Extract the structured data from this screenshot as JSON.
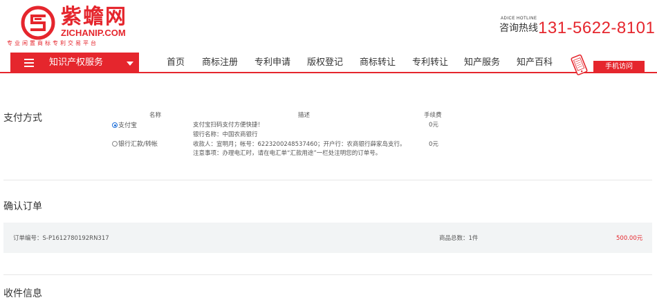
{
  "brand": {
    "name": "紫蟾网",
    "domain": "ZICHANIP.COM",
    "slogan": "专业闲置商标专利交易平台",
    "color": "#e5262d"
  },
  "hotline": {
    "label_en": "ADICE HOTLINE",
    "label_cn": "咨询热线",
    "number": "131-5622-8101"
  },
  "nav": {
    "service_menu_label": "知识产权服务",
    "items": [
      "首页",
      "商标注册",
      "专利申请",
      "版权登记",
      "商标转让",
      "专利转让",
      "知产服务",
      "知产百科"
    ],
    "mobile_button": "手机访问"
  },
  "payment": {
    "title": "支付方式",
    "headers": {
      "name": "名称",
      "desc": "描述",
      "fee": "手续费"
    },
    "options": [
      {
        "name": "支付宝",
        "selected": true,
        "desc": [
          "支付宝扫码支付方便快捷！"
        ],
        "fee": "0元"
      },
      {
        "name": "银行汇款/转帐",
        "selected": false,
        "desc": [
          "银行名称：中国农商银行",
          "收款人：宣明月；帐号：6223200248537460；开户行：农商银行薛家岛支行。",
          "注意事项：办理电汇时，请在电汇单“汇款用途”一栏处注明您的订单号。"
        ],
        "fee": "0元"
      }
    ]
  },
  "confirm": {
    "title": "确认订单",
    "order_no": "订单编号：S-P1612780192RN317",
    "count": "商品总数：1件",
    "amount": "500.00元"
  },
  "shipping": {
    "title": "收件信息"
  },
  "icons": {
    "logo": "zichan-logo-icon",
    "menu": "hamburger-icon",
    "caret": "caret-down-icon",
    "phone": "mobile-phone-icon",
    "radio": "radio-icon"
  }
}
